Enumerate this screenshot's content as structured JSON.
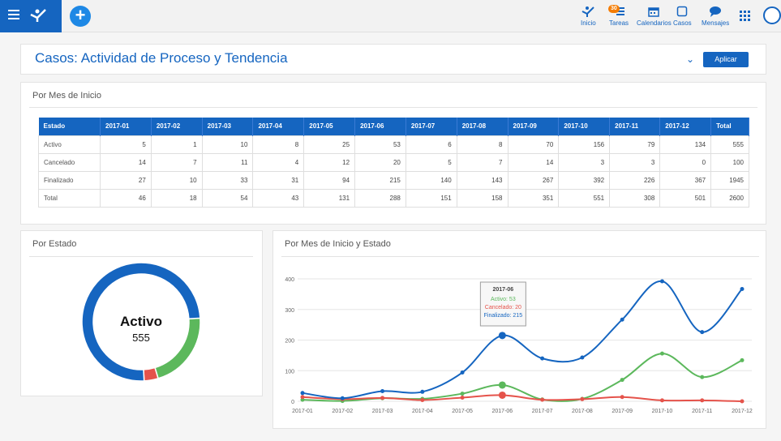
{
  "topbar": {
    "nav": [
      {
        "label": "Inicio",
        "icon": "process-icon"
      },
      {
        "label": "Tareas",
        "icon": "tasks-icon",
        "badge": "30"
      },
      {
        "label": "Calendarios",
        "icon": "calendar-icon"
      },
      {
        "label": "Casos",
        "icon": "cases-icon"
      },
      {
        "label": "Mensajes",
        "icon": "chat-icon"
      }
    ]
  },
  "header": {
    "title": "Casos: Actividad de Proceso y Tendencia",
    "apply_label": "Aplicar"
  },
  "table_section": {
    "title": "Por Mes de Inicio",
    "columns": [
      "Estado",
      "2017-01",
      "2017-02",
      "2017-03",
      "2017-04",
      "2017-05",
      "2017-06",
      "2017-07",
      "2017-08",
      "2017-09",
      "2017-10",
      "2017-11",
      "2017-12",
      "Total"
    ],
    "rows": [
      [
        "Activo",
        "5",
        "1",
        "10",
        "8",
        "25",
        "53",
        "6",
        "8",
        "70",
        "156",
        "79",
        "134",
        "555"
      ],
      [
        "Cancelado",
        "14",
        "7",
        "11",
        "4",
        "12",
        "20",
        "5",
        "7",
        "14",
        "3",
        "3",
        "0",
        "100"
      ],
      [
        "Finalizado",
        "27",
        "10",
        "33",
        "31",
        "94",
        "215",
        "140",
        "143",
        "267",
        "392",
        "226",
        "367",
        "1945"
      ],
      [
        "Total",
        "46",
        "18",
        "54",
        "43",
        "131",
        "288",
        "151",
        "158",
        "351",
        "551",
        "308",
        "501",
        "2600"
      ]
    ]
  },
  "donut_section": {
    "title": "Por Estado",
    "center_label": "Activo",
    "center_value": "555"
  },
  "line_section": {
    "title": "Por Mes de Inicio y Estado"
  },
  "colors": {
    "activo": "#5cb85c",
    "cancelado": "#e5534b",
    "finalizado": "#1565c0"
  },
  "chart_data": [
    {
      "type": "pie",
      "categories": [
        "Activo",
        "Cancelado",
        "Finalizado"
      ],
      "values": [
        555,
        100,
        1945
      ]
    },
    {
      "type": "line",
      "categories": [
        "2017-01",
        "2017-02",
        "2017-03",
        "2017-04",
        "2017-05",
        "2017-06",
        "2017-07",
        "2017-08",
        "2017-09",
        "2017-10",
        "2017-11",
        "2017-12"
      ],
      "series": [
        {
          "name": "Activo",
          "values": [
            5,
            1,
            10,
            8,
            25,
            53,
            6,
            8,
            70,
            156,
            79,
            134
          ]
        },
        {
          "name": "Cancelado",
          "values": [
            14,
            7,
            11,
            4,
            12,
            20,
            5,
            7,
            14,
            3,
            3,
            0
          ]
        },
        {
          "name": "Finalizado",
          "values": [
            27,
            10,
            33,
            31,
            94,
            215,
            140,
            143,
            267,
            392,
            226,
            367
          ]
        }
      ],
      "yticks": [
        "0",
        "100",
        "200",
        "300",
        "400"
      ],
      "ylim": [
        0,
        400
      ],
      "tooltip": {
        "title": "2017-06",
        "lines": [
          "Activo: 53",
          "Cancelado: 20",
          "Finalizado: 215"
        ]
      }
    }
  ]
}
